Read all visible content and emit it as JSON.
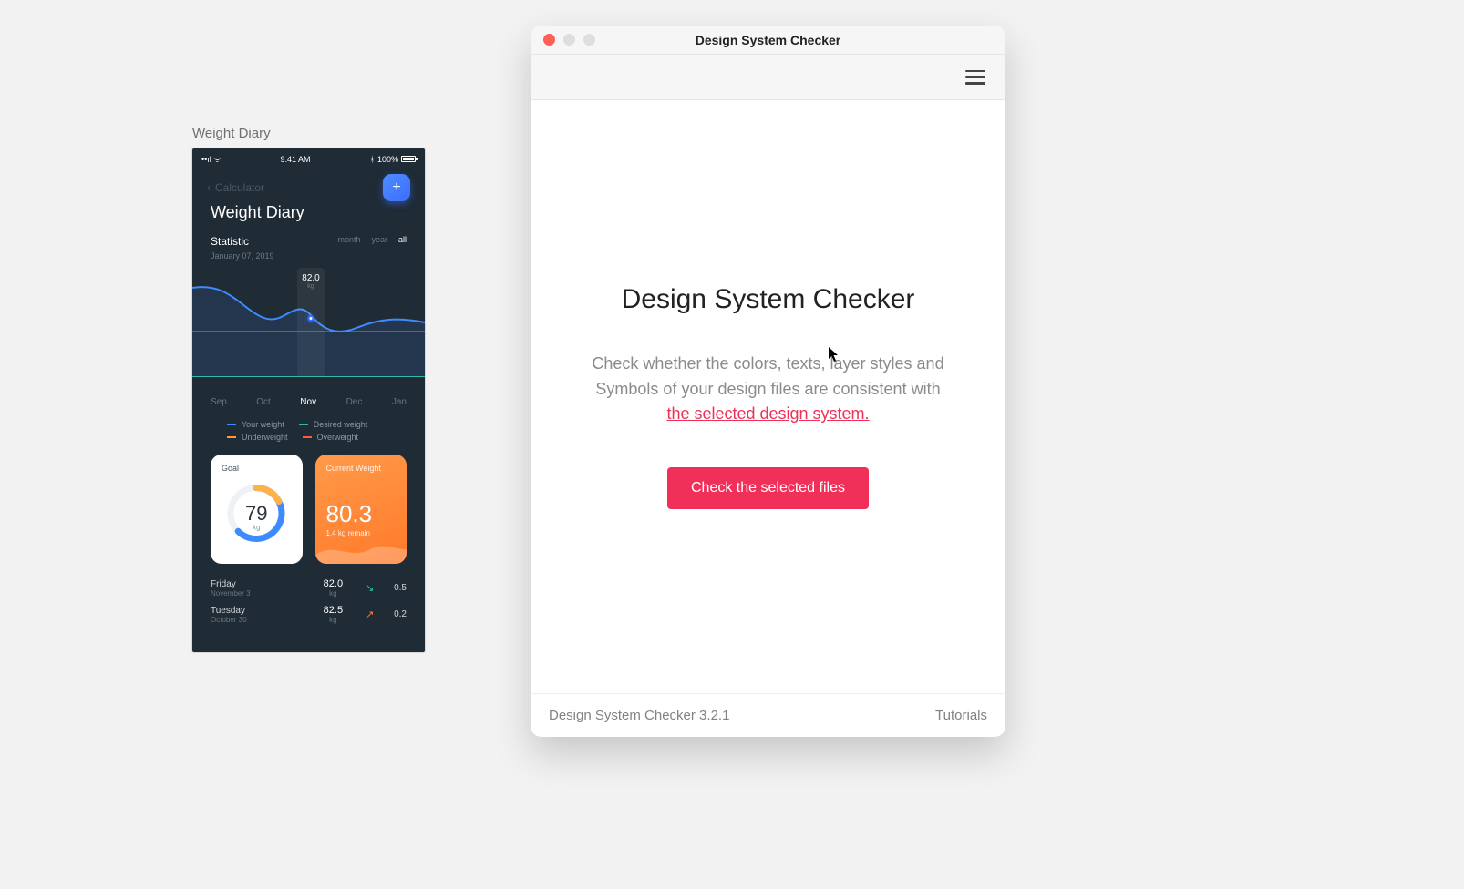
{
  "artboard": {
    "label": "Weight Diary",
    "status_time": "9:41 AM",
    "status_battery": "100%",
    "nav_back": "Calculator",
    "title": "Weight Diary",
    "statistic_label": "Statistic",
    "statistic_date": "January 07, 2019",
    "range_tabs": {
      "month": "month",
      "year": "year",
      "all": "all"
    },
    "marker_value": "82.0",
    "marker_unit": "kg",
    "months": {
      "m0": "Sep",
      "m1": "Oct",
      "m2": "Nov",
      "m3": "Dec",
      "m4": "Jan"
    },
    "legend": {
      "your_weight": "Your weight",
      "desired_weight": "Desired weight",
      "underweight": "Underweight",
      "overweight": "Overweight"
    },
    "goal_card": {
      "label": "Goal",
      "value": "79",
      "unit": "kg"
    },
    "current_card": {
      "label": "Current Weight",
      "value": "80.3",
      "remaining": "1.4 kg remain"
    },
    "log": [
      {
        "day": "Friday",
        "date": "November 3",
        "value": "82.0",
        "unit": "kg",
        "dir": "down",
        "delta": "0.5"
      },
      {
        "day": "Tuesday",
        "date": "October 30",
        "value": "82.5",
        "unit": "kg",
        "dir": "up",
        "delta": "0.2"
      }
    ]
  },
  "window": {
    "title": "Design System Checker",
    "main_title": "Design System Checker",
    "description_pre": "Check whether the colors, texts, layer styles and Symbols of your design files are consistent with ",
    "description_link": "the selected design system.",
    "check_button": "Check the selected files",
    "footer_version": "Design System Checker 3.2.1",
    "footer_tutorials": "Tutorials"
  }
}
